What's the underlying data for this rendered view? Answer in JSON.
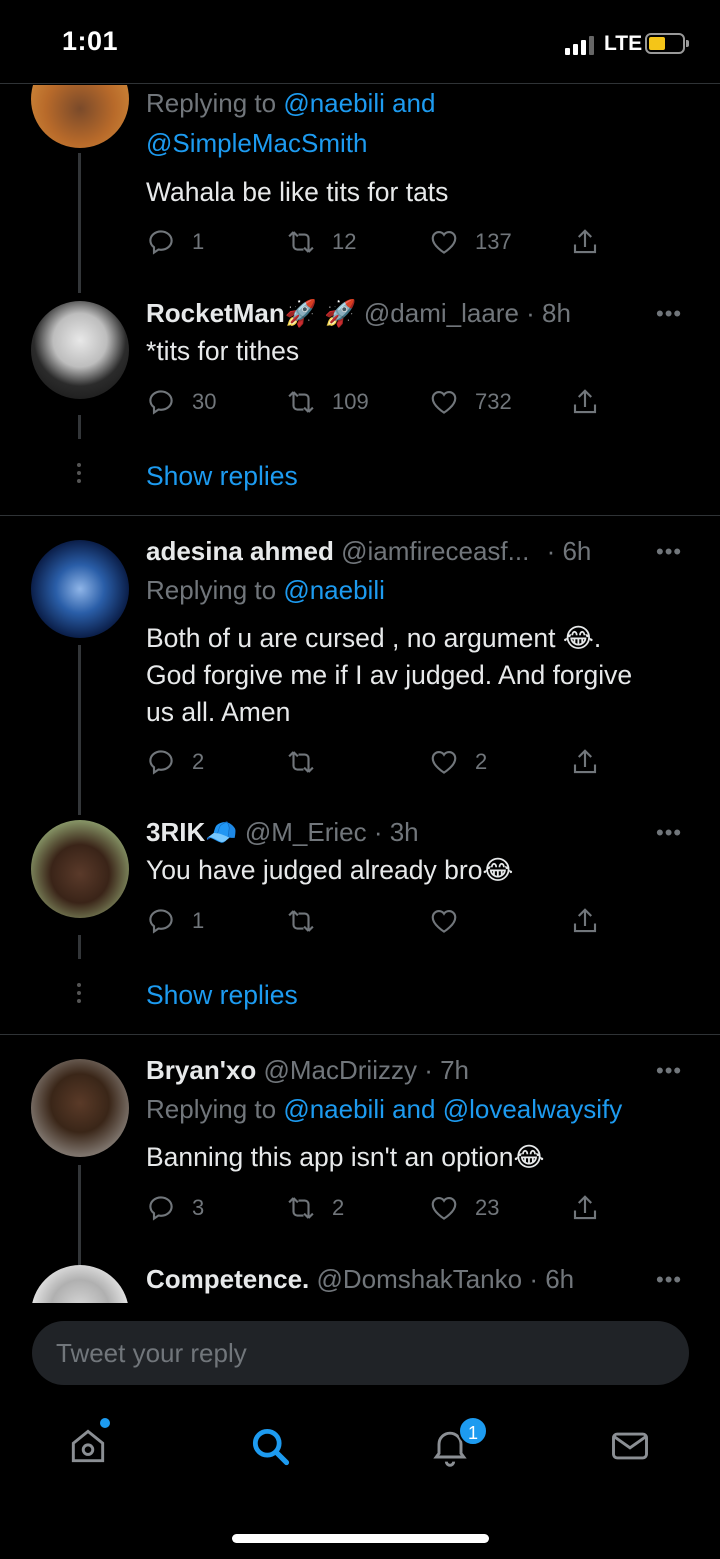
{
  "status_bar": {
    "time": "1:01",
    "network": "LTE"
  },
  "tweets": [
    {
      "reply_to_prefix": "Replying to ",
      "reply_to_line1": "@naebili and",
      "reply_to_line2": "@SimpleMacSmith",
      "text": "Wahala be like tits for tats",
      "replies": "1",
      "retweets": "12",
      "likes": "137"
    },
    {
      "name": "RocketMan🚀 🚀",
      "handle": "@dami_laare",
      "time": "· 8h",
      "text": "*tits for tithes",
      "replies": "30",
      "retweets": "109",
      "likes": "732",
      "show_replies": "Show replies"
    },
    {
      "name": "adesina ahmed",
      "handle": "@iamfireceasf...",
      "time": "· 6h",
      "reply_to_prefix": "Replying to ",
      "reply_to": "@naebili",
      "text_lines": [
        "Both of u are cursed , no argument 😂.",
        "God forgive me if I av judged. And forgive",
        "us all. Amen"
      ],
      "replies": "2",
      "retweets": "",
      "likes": "2"
    },
    {
      "name": "3RIK🧢",
      "handle": "@M_Eriec",
      "time": "· 3h",
      "text": "You have judged already bro😂",
      "replies": "1",
      "retweets": "",
      "likes": "",
      "show_replies": "Show replies"
    },
    {
      "name": "Bryan'xo",
      "handle": "@MacDriizzy",
      "time": "· 7h",
      "reply_to_prefix": "Replying to ",
      "reply_to": "@naebili and @lovealwaysify",
      "text": "Banning this app isn't an option😂",
      "replies": "3",
      "retweets": "2",
      "likes": "23"
    },
    {
      "name": "Competence.",
      "handle": "@DomshakTanko",
      "time": "· 6h"
    }
  ],
  "more_label": "•••",
  "reply_input": {
    "placeholder": "Tweet your reply"
  },
  "nav": {
    "notifications_badge": "1"
  },
  "colors": {
    "accent": "#1d9bf0",
    "background": "#000000",
    "muted": "#71767b"
  }
}
